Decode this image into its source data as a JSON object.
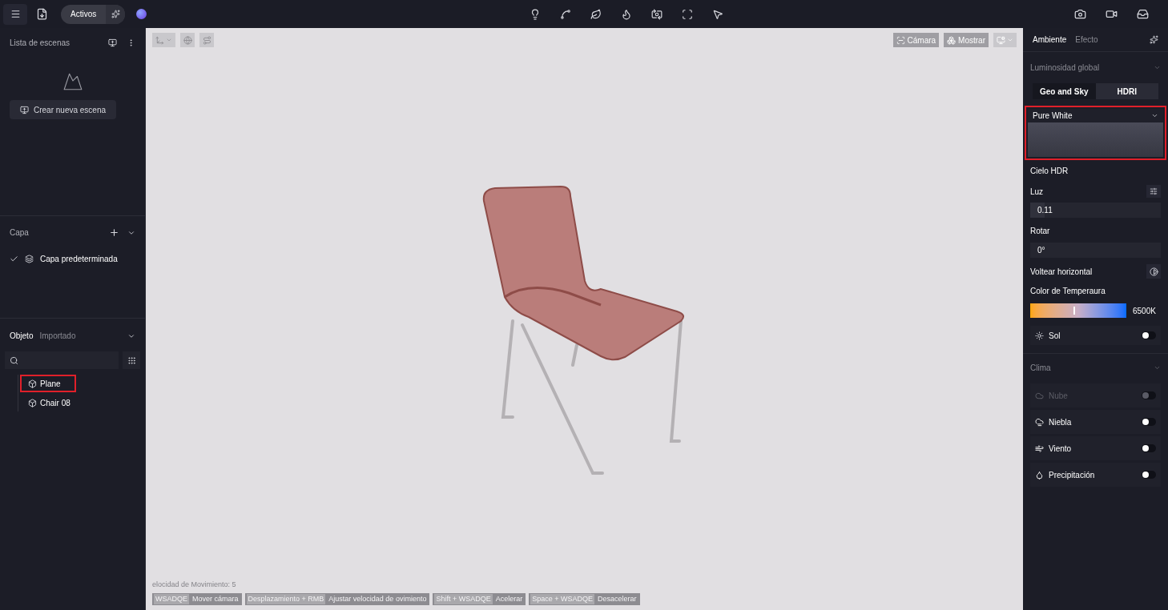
{
  "top_bar": {
    "assets_label": "Activos"
  },
  "scene_list": {
    "title": "Lista de escenas",
    "create_button": "Crear nueva escena"
  },
  "layers": {
    "title": "Capa",
    "items": [
      {
        "label": "Capa predeterminada",
        "checked": true
      }
    ]
  },
  "objects": {
    "tabs": [
      {
        "label": "Objeto",
        "selected": true
      },
      {
        "label": "Importado",
        "selected": false
      }
    ],
    "items": [
      {
        "label": "Plane",
        "highlighted": true
      },
      {
        "label": "Chair 08",
        "highlighted": false
      }
    ]
  },
  "viewport": {
    "buttons": [
      {
        "label": "Cámara"
      },
      {
        "label": "Mostrar"
      }
    ],
    "speed_text": "elocidad de Movimiento: 5",
    "shortcuts": [
      {
        "keys": "WSADQE",
        "action": "Mover cámara"
      },
      {
        "keys": "Desplazamiento + RMB",
        "action": "Ajustar velocidad de ovimiento"
      },
      {
        "keys": "Shift + WSADQE",
        "action": "Acelerar"
      },
      {
        "keys": "Space + WSADQE",
        "action": "Desacelerar"
      }
    ]
  },
  "right_panel": {
    "tabs": [
      {
        "label": "Ambiente",
        "selected": true
      },
      {
        "label": "Efecto",
        "selected": false
      }
    ],
    "global_light": {
      "title": "Luminosidad global",
      "modes": [
        {
          "label": "Geo and Sky",
          "selected": false
        },
        {
          "label": "HDRI",
          "selected": true
        }
      ],
      "preset": {
        "value": "Pure White",
        "highlighted": true
      },
      "hdr_label": "Cielo HDR",
      "light": {
        "label": "Luz",
        "value": "0.11",
        "level": 0.11
      },
      "rotate": {
        "label": "Rotar",
        "value": "0°"
      },
      "flip_label": "Voltear horizontal",
      "temperature": {
        "label": "Color de Temperaura",
        "level": 0.45,
        "reading": "6500K"
      },
      "sun": {
        "label": "Sol",
        "on": false
      }
    },
    "weather": {
      "title": "Clima",
      "items": [
        {
          "label": "Nube",
          "on": false,
          "disabled": true
        },
        {
          "label": "Niebla",
          "on": false,
          "disabled": false
        },
        {
          "label": "Viento",
          "on": false,
          "disabled": false
        },
        {
          "label": "Precipitación",
          "on": false,
          "disabled": false
        }
      ]
    }
  }
}
